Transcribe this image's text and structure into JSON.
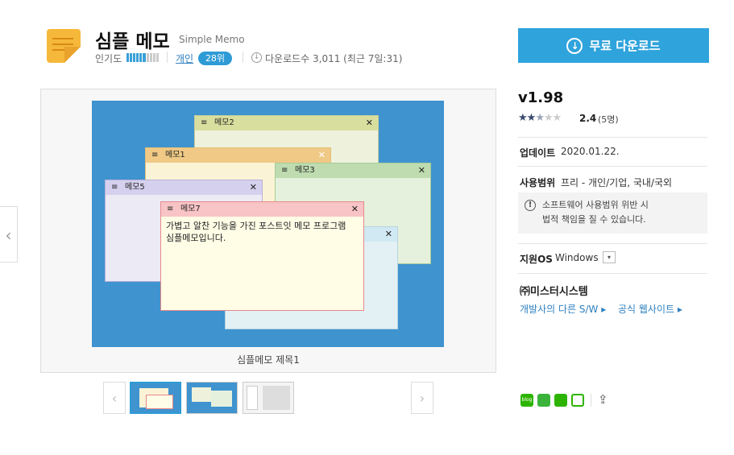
{
  "header": {
    "title": "심플 메모",
    "subtitle": "Simple Memo",
    "popularity_label": "인기도",
    "category": "개인",
    "rank": "28위",
    "downloads": "다운로드수 3,011 (최근 7일:31)",
    "popularity_level": 0.6
  },
  "screenshot": {
    "caption": "심플메모 제목1",
    "memos": [
      {
        "title": "메모2",
        "close": "✕"
      },
      {
        "title": "메모1",
        "close": "✕"
      },
      {
        "title": "메모3",
        "close": "✕"
      },
      {
        "title": "메모5",
        "close": "✕"
      },
      {
        "title": "메모7",
        "close": "✕",
        "line1": "가볍고 알찬 기능을 가진 포스트잇 메모 프로그램",
        "line2": "심플메모입니다."
      },
      {
        "title": "",
        "close": "✕"
      }
    ],
    "menu_glyph": "≡"
  },
  "nav": {
    "prev": "‹",
    "next": "›"
  },
  "sidebar": {
    "download_button": "무료 다운로드",
    "version": "v1.98",
    "rating": "2.4",
    "rating_count": "(5명)",
    "rating_value": 2.4,
    "update_label": "업데이트",
    "update_value": "2020.01.22.",
    "license_label": "사용범위",
    "license_value": "프리 - 개인/기업, 국내/국외",
    "warning_line1": "소프트웨어 사용범위 위반 시",
    "warning_line2": "법적 책임을 질 수 있습니다.",
    "os_label": "지원OS",
    "os_value": "Windows",
    "developer": "㈜미스터시스템",
    "dev_other_link": "개발사의 다른 S/W",
    "official_site_link": "공식 웹사이트"
  }
}
